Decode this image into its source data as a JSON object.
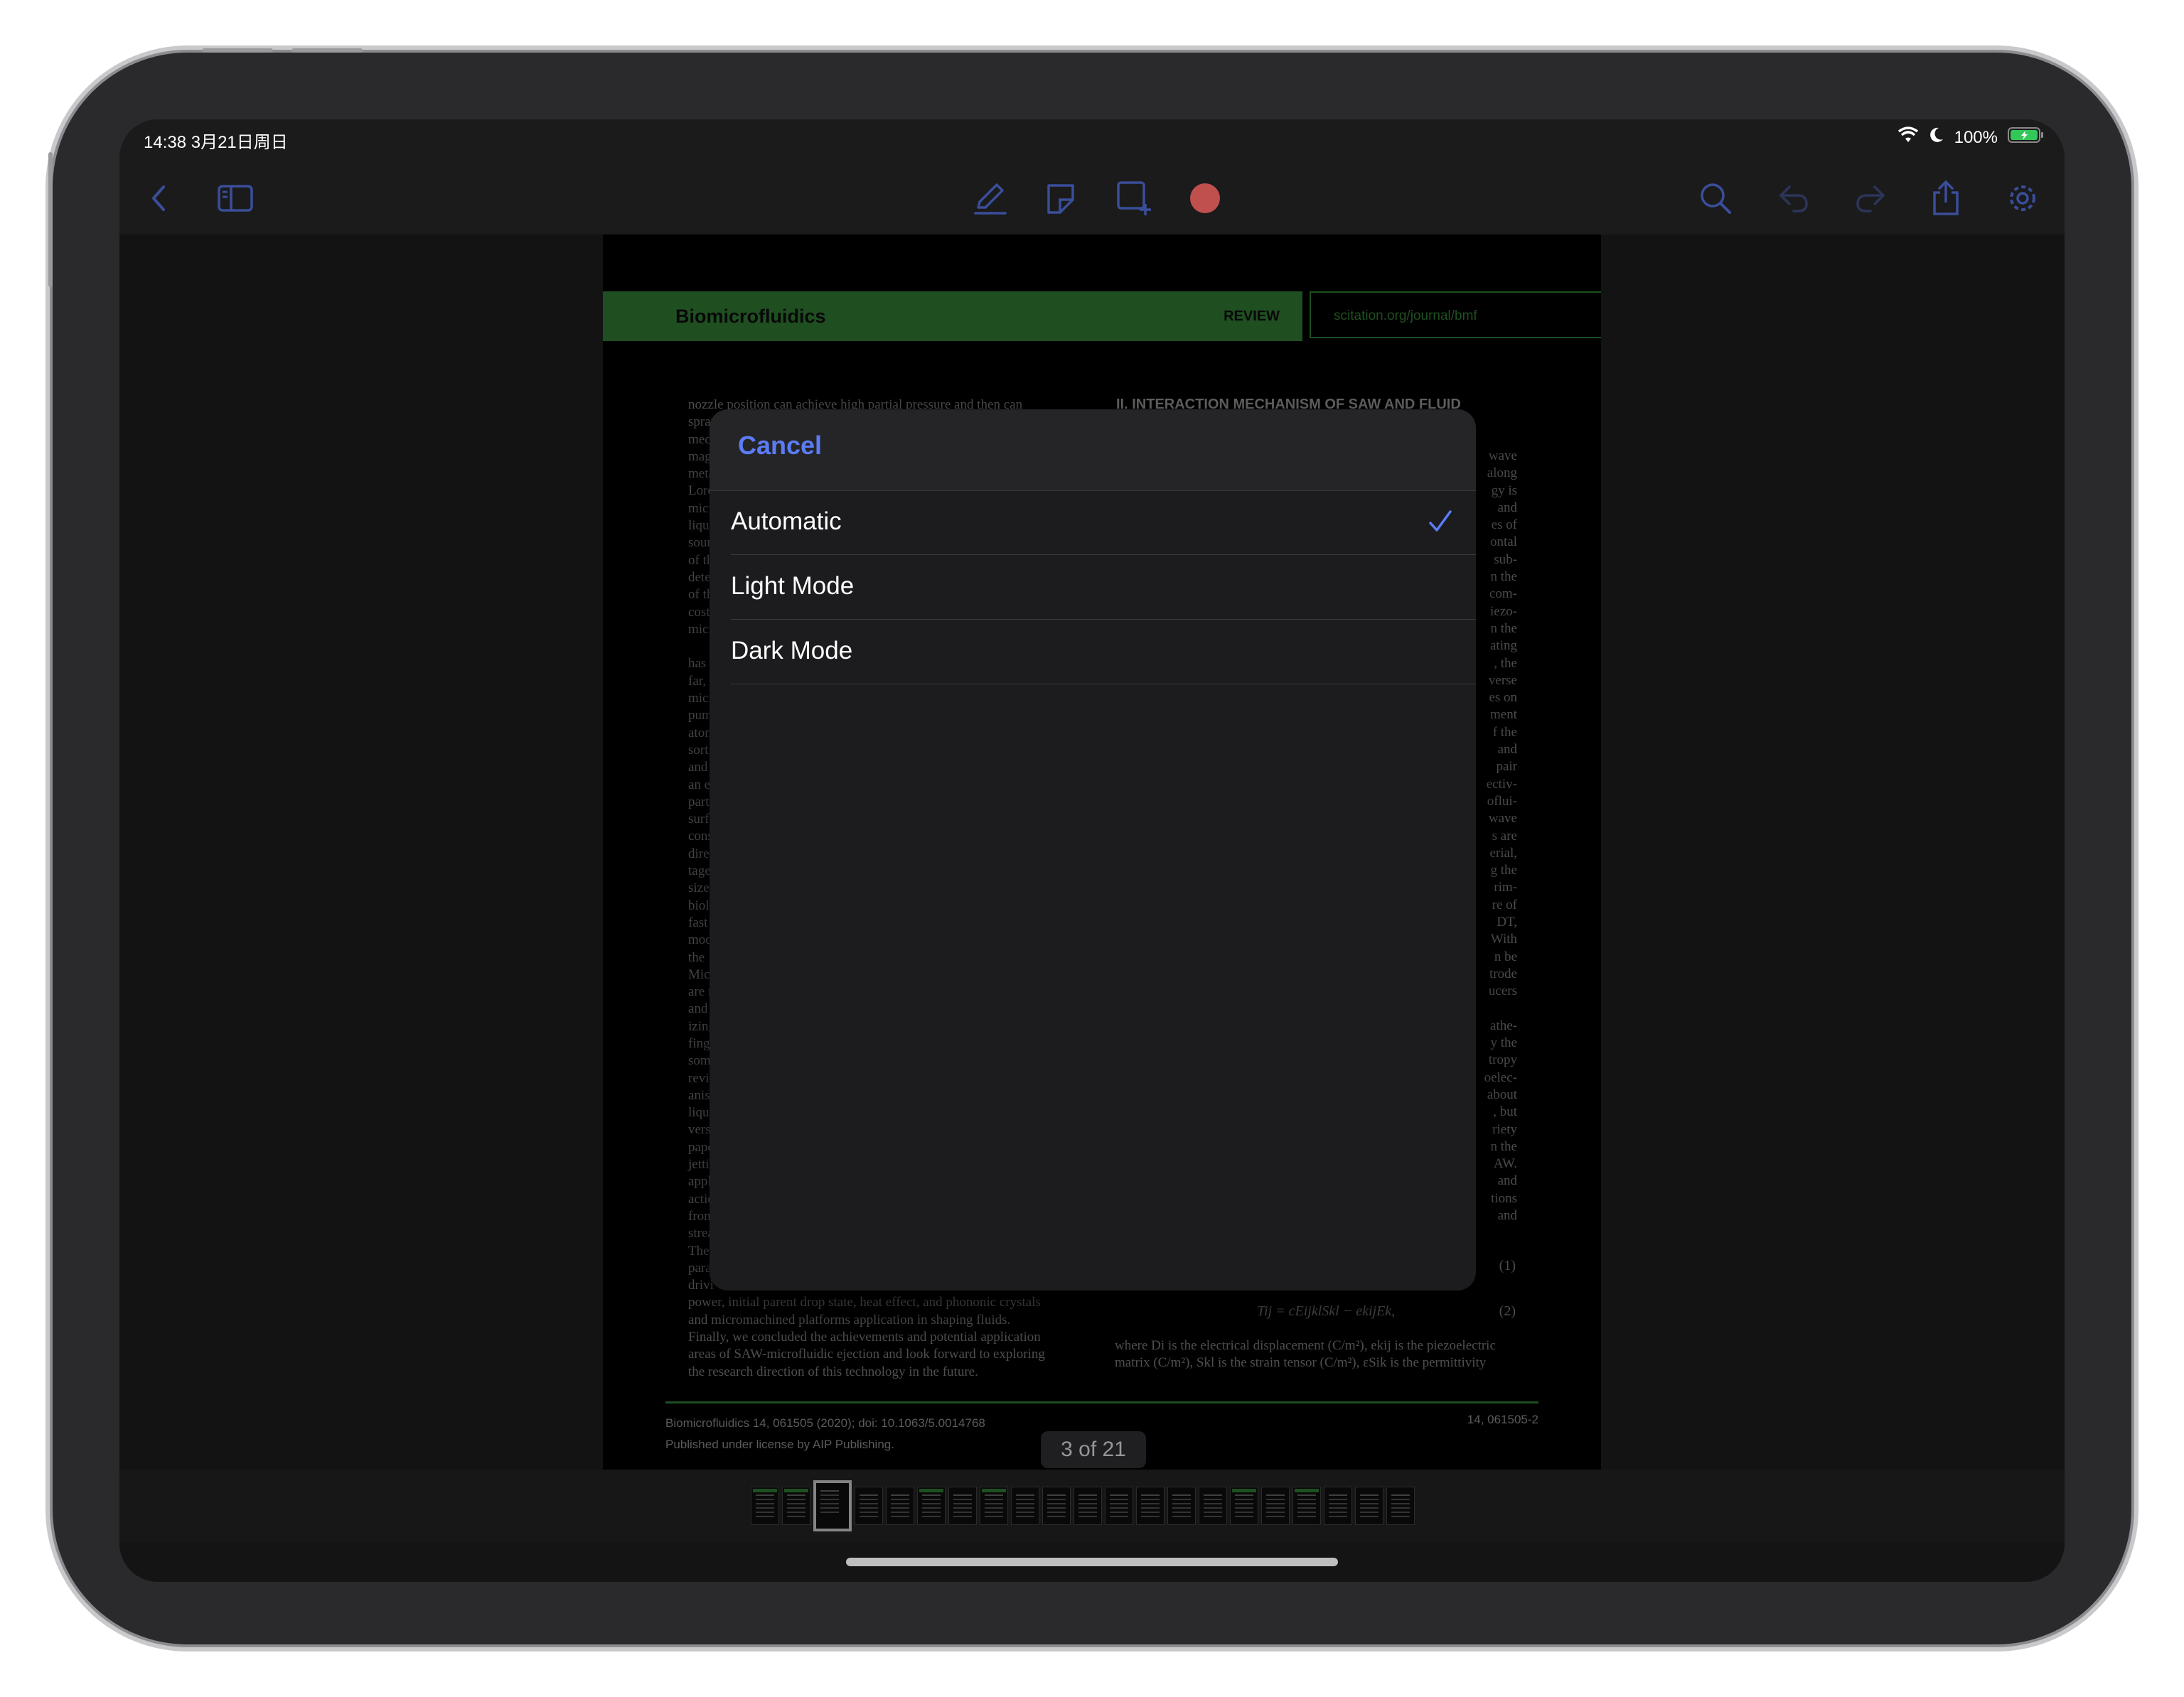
{
  "status_bar": {
    "time_date": "14:38   3月21日周日",
    "battery": "100%"
  },
  "toolbar": {
    "icons": [
      "back-chevron-icon",
      "sidebar-icon",
      "pencil-icon",
      "eraser-icon",
      "add-shape-icon",
      "record-icon",
      "search-icon",
      "undo-icon",
      "redo-icon",
      "share-icon",
      "gear-icon"
    ],
    "accent_color": "#3a4e9a",
    "record_color": "#c0504d"
  },
  "document": {
    "journal": "Biomicrofluidics",
    "article_type": "REVIEW",
    "url": "scitation.org/journal/bmf",
    "section_heading": "II. INTERACTION MECHANISM OF SAW AND FLUID",
    "left_column": {
      "first_line": "nozzle position can achieve high partial pressure and then can",
      "fragments": [
        "spray",
        "mech",
        "mag",
        "meta",
        "Lore",
        "micro",
        "liqui",
        "soun",
        "of th",
        "deter",
        "of th",
        "costl",
        "micr",
        "",
        "has",
        "far, S",
        "micro",
        "pump",
        "atom",
        "sortin",
        "and",
        "an e",
        "partic",
        "surfa",
        "const",
        "direc",
        "tages",
        "size t",
        "biolo",
        "fast",
        "mode",
        "the",
        "Micr",
        "are n",
        "and c",
        "izing",
        "finge",
        "some",
        "revie",
        "anism",
        "liqui",
        "versa",
        "pape",
        "jettin",
        "appli",
        "actio",
        "from",
        "strea",
        "Then",
        "para",
        "drivi"
      ],
      "tail_lines": [
        "power, initial parent drop state, heat effect, and phononic crystals",
        "and micromachined platforms application in shaping fluids.",
        "Finally, we concluded the achievements and potential application",
        "areas of SAW-microfluidic ejection and look forward to exploring",
        "the research direction of this technology in the future."
      ]
    },
    "right_column": {
      "fragments": [
        "wave",
        "along",
        "gy is",
        "and",
        "es of",
        "ontal",
        "sub-",
        "n the",
        "com-",
        "iezo-",
        "n the",
        "ating",
        ", the",
        "verse",
        "es on",
        "ment",
        "f the",
        "and",
        "pair",
        "ectiv-",
        "oflui-",
        "wave",
        "s are",
        "erial,",
        "g the",
        "rim-",
        "re of",
        "DT,",
        "With",
        "n be",
        "trode",
        "ucers",
        "",
        "athe-",
        "y the",
        "tropy",
        "oelec-",
        "about",
        ", but",
        "riety",
        "n the",
        "AW.",
        "and",
        "tions",
        "and"
      ],
      "eq1_number": "(1)",
      "eq2": "Tij = cEijklSkl − ekijEk,",
      "eq2_number": "(2)",
      "tail_lines": [
        "where Di is the electrical displacement (C/m²), ekij is the piezoelectric",
        "matrix (C/m²), Skl is the strain tensor (C/m²), εSik is the permittivity"
      ]
    },
    "footer": {
      "citation": "Biomicrofluidics 14, 061505 (2020); doi: 10.1063/5.0014768",
      "license": "Published under license by AIP Publishing.",
      "page_number": "14, 061505-2"
    },
    "page_indicator": "3 of 21",
    "thumbnail_count": 21,
    "current_page_index": 3
  },
  "appearance_sheet": {
    "cancel_label": "Cancel",
    "options": [
      {
        "label": "Automatic",
        "selected": true
      },
      {
        "label": "Light Mode",
        "selected": false
      },
      {
        "label": "Dark Mode",
        "selected": false
      }
    ],
    "accent_color": "#5b7cf5"
  }
}
